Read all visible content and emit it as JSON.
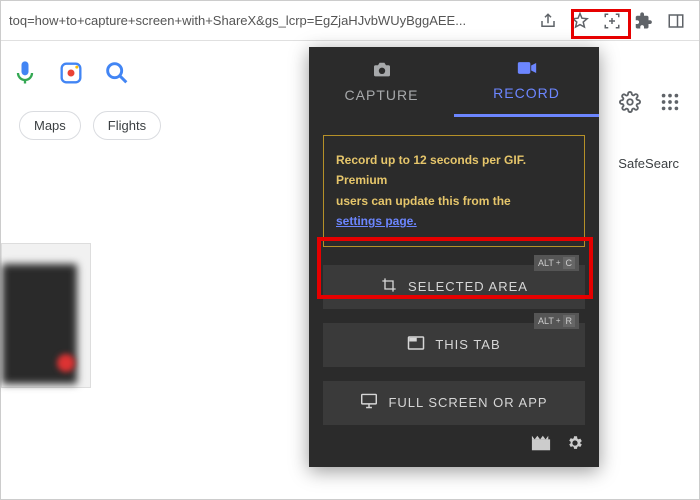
{
  "browser": {
    "url_fragment": "toq=how+to+capture+screen+with+ShareX&gs_lcrp=EgZjaHJvbWUyBggAEE..."
  },
  "chips": {
    "maps": "Maps",
    "flights": "Flights"
  },
  "safesearch": "SafeSearc",
  "extension": {
    "tabs": {
      "capture": "CAPTURE",
      "record": "RECORD"
    },
    "notice": {
      "line1": "Record up to 12 seconds per GIF. Premium",
      "line2": "users can update this from the ",
      "link": "settings page."
    },
    "buttons": {
      "selected_area": "SELECTED AREA",
      "this_tab": "THIS TAB",
      "full_screen": "FULL SCREEN OR APP"
    },
    "shortcuts": {
      "alt": "ALT",
      "plus": "+",
      "c": "C",
      "r": "R"
    }
  }
}
